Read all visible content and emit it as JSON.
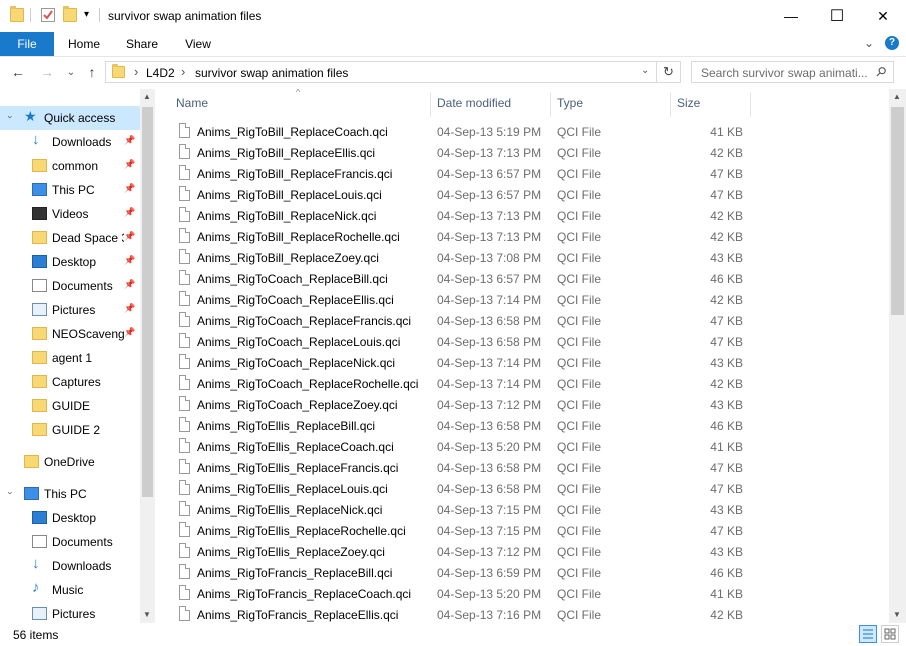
{
  "window": {
    "title": "survivor swap animation files",
    "minimize_glyph": "—",
    "maximize_glyph": "☐",
    "close_glyph": "✕"
  },
  "ribbon": {
    "tabs": [
      "File",
      "Home",
      "Share",
      "View"
    ],
    "expand_glyph": "⌄",
    "help_glyph": "?"
  },
  "nav": {
    "back_glyph": "←",
    "forward_glyph": "→",
    "recent_glyph": "⌄",
    "up_glyph": "↑",
    "breadcrumb": [
      "L4D2",
      "survivor swap animation files"
    ],
    "breadcrumb_separator": "›",
    "dropdown_glyph": "⌄",
    "refresh_glyph": "↻",
    "search_placeholder": "Search survivor swap animati...",
    "search_glyph": "⚲"
  },
  "sidebar": {
    "quick_access": "Quick access",
    "items": [
      {
        "label": "Downloads",
        "icon": "download-icon",
        "pinned": true
      },
      {
        "label": "common",
        "icon": "folder-icon",
        "pinned": true
      },
      {
        "label": "This PC",
        "icon": "monitor-icon",
        "pinned": true
      },
      {
        "label": "Videos",
        "icon": "video-icon",
        "pinned": true
      },
      {
        "label": "Dead Space 3",
        "icon": "folder-icon",
        "pinned": true
      },
      {
        "label": "Desktop",
        "icon": "desktop-icon",
        "pinned": true
      },
      {
        "label": "Documents",
        "icon": "documents-icon",
        "pinned": true
      },
      {
        "label": "Pictures",
        "icon": "pictures-icon",
        "pinned": true
      },
      {
        "label": "NEOScavenger",
        "icon": "folder-icon",
        "pinned": true
      },
      {
        "label": "agent 1",
        "icon": "folder-icon",
        "pinned": false
      },
      {
        "label": "Captures",
        "icon": "folder-icon",
        "pinned": false
      },
      {
        "label": "GUIDE",
        "icon": "folder-icon",
        "pinned": false
      },
      {
        "label": "GUIDE 2",
        "icon": "folder-icon",
        "pinned": false
      }
    ],
    "onedrive": "OneDrive",
    "this_pc": "This PC",
    "this_pc_items": [
      {
        "label": "Desktop",
        "icon": "desktop-icon"
      },
      {
        "label": "Documents",
        "icon": "documents-icon"
      },
      {
        "label": "Downloads",
        "icon": "download-icon"
      },
      {
        "label": "Music",
        "icon": "music-icon"
      },
      {
        "label": "Pictures",
        "icon": "pictures-icon"
      }
    ],
    "pin_glyph": "📌",
    "collapse_glyph": "›"
  },
  "columns": {
    "name": "Name",
    "date": "Date modified",
    "type": "Type",
    "size": "Size",
    "sort_glyph": "^"
  },
  "files": [
    {
      "name": "Anims_RigToBill_ReplaceCoach.qci",
      "date": "04-Sep-13 5:19 PM",
      "type": "QCI File",
      "size": "41 KB"
    },
    {
      "name": "Anims_RigToBill_ReplaceEllis.qci",
      "date": "04-Sep-13 7:13 PM",
      "type": "QCI File",
      "size": "42 KB"
    },
    {
      "name": "Anims_RigToBill_ReplaceFrancis.qci",
      "date": "04-Sep-13 6:57 PM",
      "type": "QCI File",
      "size": "47 KB"
    },
    {
      "name": "Anims_RigToBill_ReplaceLouis.qci",
      "date": "04-Sep-13 6:57 PM",
      "type": "QCI File",
      "size": "47 KB"
    },
    {
      "name": "Anims_RigToBill_ReplaceNick.qci",
      "date": "04-Sep-13 7:13 PM",
      "type": "QCI File",
      "size": "42 KB"
    },
    {
      "name": "Anims_RigToBill_ReplaceRochelle.qci",
      "date": "04-Sep-13 7:13 PM",
      "type": "QCI File",
      "size": "42 KB"
    },
    {
      "name": "Anims_RigToBill_ReplaceZoey.qci",
      "date": "04-Sep-13 7:08 PM",
      "type": "QCI File",
      "size": "43 KB"
    },
    {
      "name": "Anims_RigToCoach_ReplaceBill.qci",
      "date": "04-Sep-13 6:57 PM",
      "type": "QCI File",
      "size": "46 KB"
    },
    {
      "name": "Anims_RigToCoach_ReplaceEllis.qci",
      "date": "04-Sep-13 7:14 PM",
      "type": "QCI File",
      "size": "42 KB"
    },
    {
      "name": "Anims_RigToCoach_ReplaceFrancis.qci",
      "date": "04-Sep-13 6:58 PM",
      "type": "QCI File",
      "size": "47 KB"
    },
    {
      "name": "Anims_RigToCoach_ReplaceLouis.qci",
      "date": "04-Sep-13 6:58 PM",
      "type": "QCI File",
      "size": "47 KB"
    },
    {
      "name": "Anims_RigToCoach_ReplaceNick.qci",
      "date": "04-Sep-13 7:14 PM",
      "type": "QCI File",
      "size": "43 KB"
    },
    {
      "name": "Anims_RigToCoach_ReplaceRochelle.qci",
      "date": "04-Sep-13 7:14 PM",
      "type": "QCI File",
      "size": "42 KB"
    },
    {
      "name": "Anims_RigToCoach_ReplaceZoey.qci",
      "date": "04-Sep-13 7:12 PM",
      "type": "QCI File",
      "size": "43 KB"
    },
    {
      "name": "Anims_RigToEllis_ReplaceBill.qci",
      "date": "04-Sep-13 6:58 PM",
      "type": "QCI File",
      "size": "46 KB"
    },
    {
      "name": "Anims_RigToEllis_ReplaceCoach.qci",
      "date": "04-Sep-13 5:20 PM",
      "type": "QCI File",
      "size": "41 KB"
    },
    {
      "name": "Anims_RigToEllis_ReplaceFrancis.qci",
      "date": "04-Sep-13 6:58 PM",
      "type": "QCI File",
      "size": "47 KB"
    },
    {
      "name": "Anims_RigToEllis_ReplaceLouis.qci",
      "date": "04-Sep-13 6:58 PM",
      "type": "QCI File",
      "size": "47 KB"
    },
    {
      "name": "Anims_RigToEllis_ReplaceNick.qci",
      "date": "04-Sep-13 7:15 PM",
      "type": "QCI File",
      "size": "43 KB"
    },
    {
      "name": "Anims_RigToEllis_ReplaceRochelle.qci",
      "date": "04-Sep-13 7:15 PM",
      "type": "QCI File",
      "size": "47 KB"
    },
    {
      "name": "Anims_RigToEllis_ReplaceZoey.qci",
      "date": "04-Sep-13 7:12 PM",
      "type": "QCI File",
      "size": "43 KB"
    },
    {
      "name": "Anims_RigToFrancis_ReplaceBill.qci",
      "date": "04-Sep-13 6:59 PM",
      "type": "QCI File",
      "size": "46 KB"
    },
    {
      "name": "Anims_RigToFrancis_ReplaceCoach.qci",
      "date": "04-Sep-13 5:20 PM",
      "type": "QCI File",
      "size": "41 KB"
    },
    {
      "name": "Anims_RigToFrancis_ReplaceEllis.qci",
      "date": "04-Sep-13 7:16 PM",
      "type": "QCI File",
      "size": "42 KB"
    }
  ],
  "status": {
    "item_count": "56 items"
  },
  "colors": {
    "file_tab": "#1979ca",
    "selected_nav": "#cce8ff",
    "header_text": "#4c607a",
    "folder": "#f8d775"
  }
}
